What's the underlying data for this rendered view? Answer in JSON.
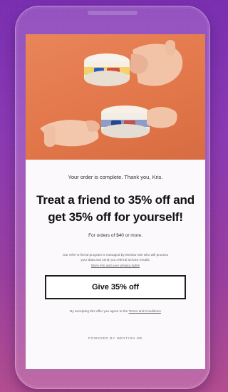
{
  "modal": {
    "order_message": "Your order is complete. Thank you, Kris.",
    "headline": "Treat a friend to 35% off and get 35% off for yourself!",
    "subhead": "For orders of $40 or more.",
    "privacy_text": "Our refer-a-friend program is managed by Mention Me who will process your data and send you referral service emails.",
    "privacy_link": "More info and your privacy rights",
    "cta_label": "Give 35% off",
    "terms_prefix": "By accepting this offer you agree to the",
    "terms_link": "Terms and Conditions",
    "powered_by": "POWERED BY MENTION ME"
  },
  "hero": {
    "background_color": "#e57e52",
    "icons": [
      "product-tin-icon",
      "hand-icon"
    ]
  }
}
